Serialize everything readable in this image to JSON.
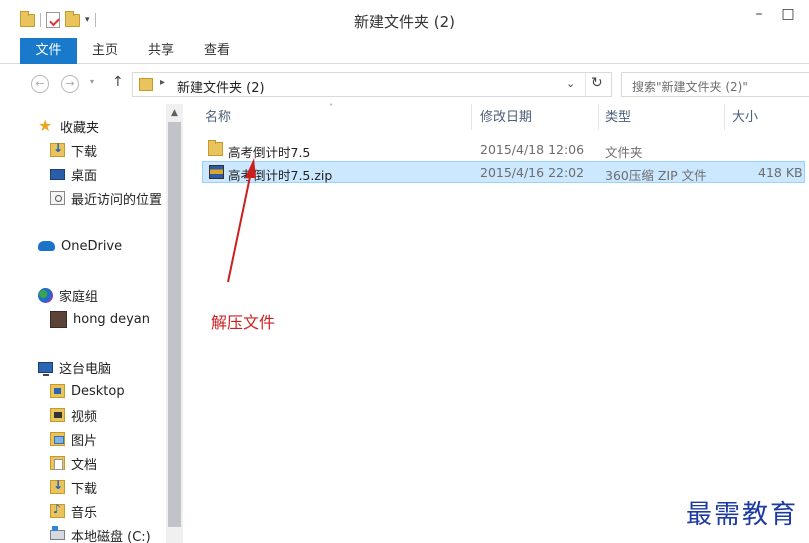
{
  "window": {
    "title": "新建文件夹 (2)",
    "minimize_glyph": "–",
    "maximize_glyph": "□"
  },
  "quick_access": {
    "dropdown_glyph": "▾"
  },
  "ribbon": {
    "tabs": [
      {
        "label": "文件",
        "active": true
      },
      {
        "label": "主页"
      },
      {
        "label": "共享"
      },
      {
        "label": "查看"
      }
    ]
  },
  "address_bar": {
    "back_glyph": "←",
    "forward_glyph": "→",
    "recent_glyph": "▾",
    "up_glyph": "↑",
    "breadcrumb_separator": "▸",
    "path": "新建文件夹 (2)",
    "dropdown_glyph": "⌄",
    "refresh_glyph": "↻",
    "search_placeholder": "搜索\"新建文件夹 (2)\""
  },
  "sidebar": {
    "scroll_up_glyph": "▲",
    "items": [
      {
        "label": "收藏夹",
        "icon": "star-icon"
      },
      {
        "label": "下载",
        "icon": "download-folder-icon"
      },
      {
        "label": "桌面",
        "icon": "desktop-icon"
      },
      {
        "label": "最近访问的位置",
        "icon": "recent-places-icon"
      },
      {
        "label": "OneDrive",
        "icon": "onedrive-cloud-icon"
      },
      {
        "label": "家庭组",
        "icon": "homegroup-icon"
      },
      {
        "label": "hong deyan",
        "icon": "user-avatar-icon"
      },
      {
        "label": "这台电脑",
        "icon": "this-pc-icon"
      },
      {
        "label": "Desktop",
        "icon": "desktop-folder-icon"
      },
      {
        "label": "视频",
        "icon": "videos-folder-icon"
      },
      {
        "label": "图片",
        "icon": "pictures-folder-icon"
      },
      {
        "label": "文档",
        "icon": "documents-folder-icon"
      },
      {
        "label": "下载",
        "icon": "downloads-folder-icon"
      },
      {
        "label": "音乐",
        "icon": "music-folder-icon"
      },
      {
        "label": "本地磁盘 (C:)",
        "icon": "local-disk-icon"
      }
    ]
  },
  "file_list": {
    "sort_glyph": "˄",
    "columns": [
      "名称",
      "修改日期",
      "类型",
      "大小"
    ],
    "rows": [
      {
        "name": "高考倒计时7.5",
        "modified": "2015/4/18 12:06",
        "type": "文件夹",
        "size": "",
        "icon": "folder-icon",
        "selected": false
      },
      {
        "name": "高考倒计时7.5.zip",
        "modified": "2015/4/16 22:02",
        "type": "360压缩 ZIP 文件",
        "size": "418 KB",
        "icon": "zip-archive-icon",
        "selected": true
      }
    ]
  },
  "annotation": {
    "label": "解压文件",
    "color": "#cc2020"
  },
  "watermark": {
    "text": "最需教育"
  },
  "colors": {
    "accent": "#1979ca",
    "selection": "#cce8ff",
    "header_text": "#4c607a"
  }
}
